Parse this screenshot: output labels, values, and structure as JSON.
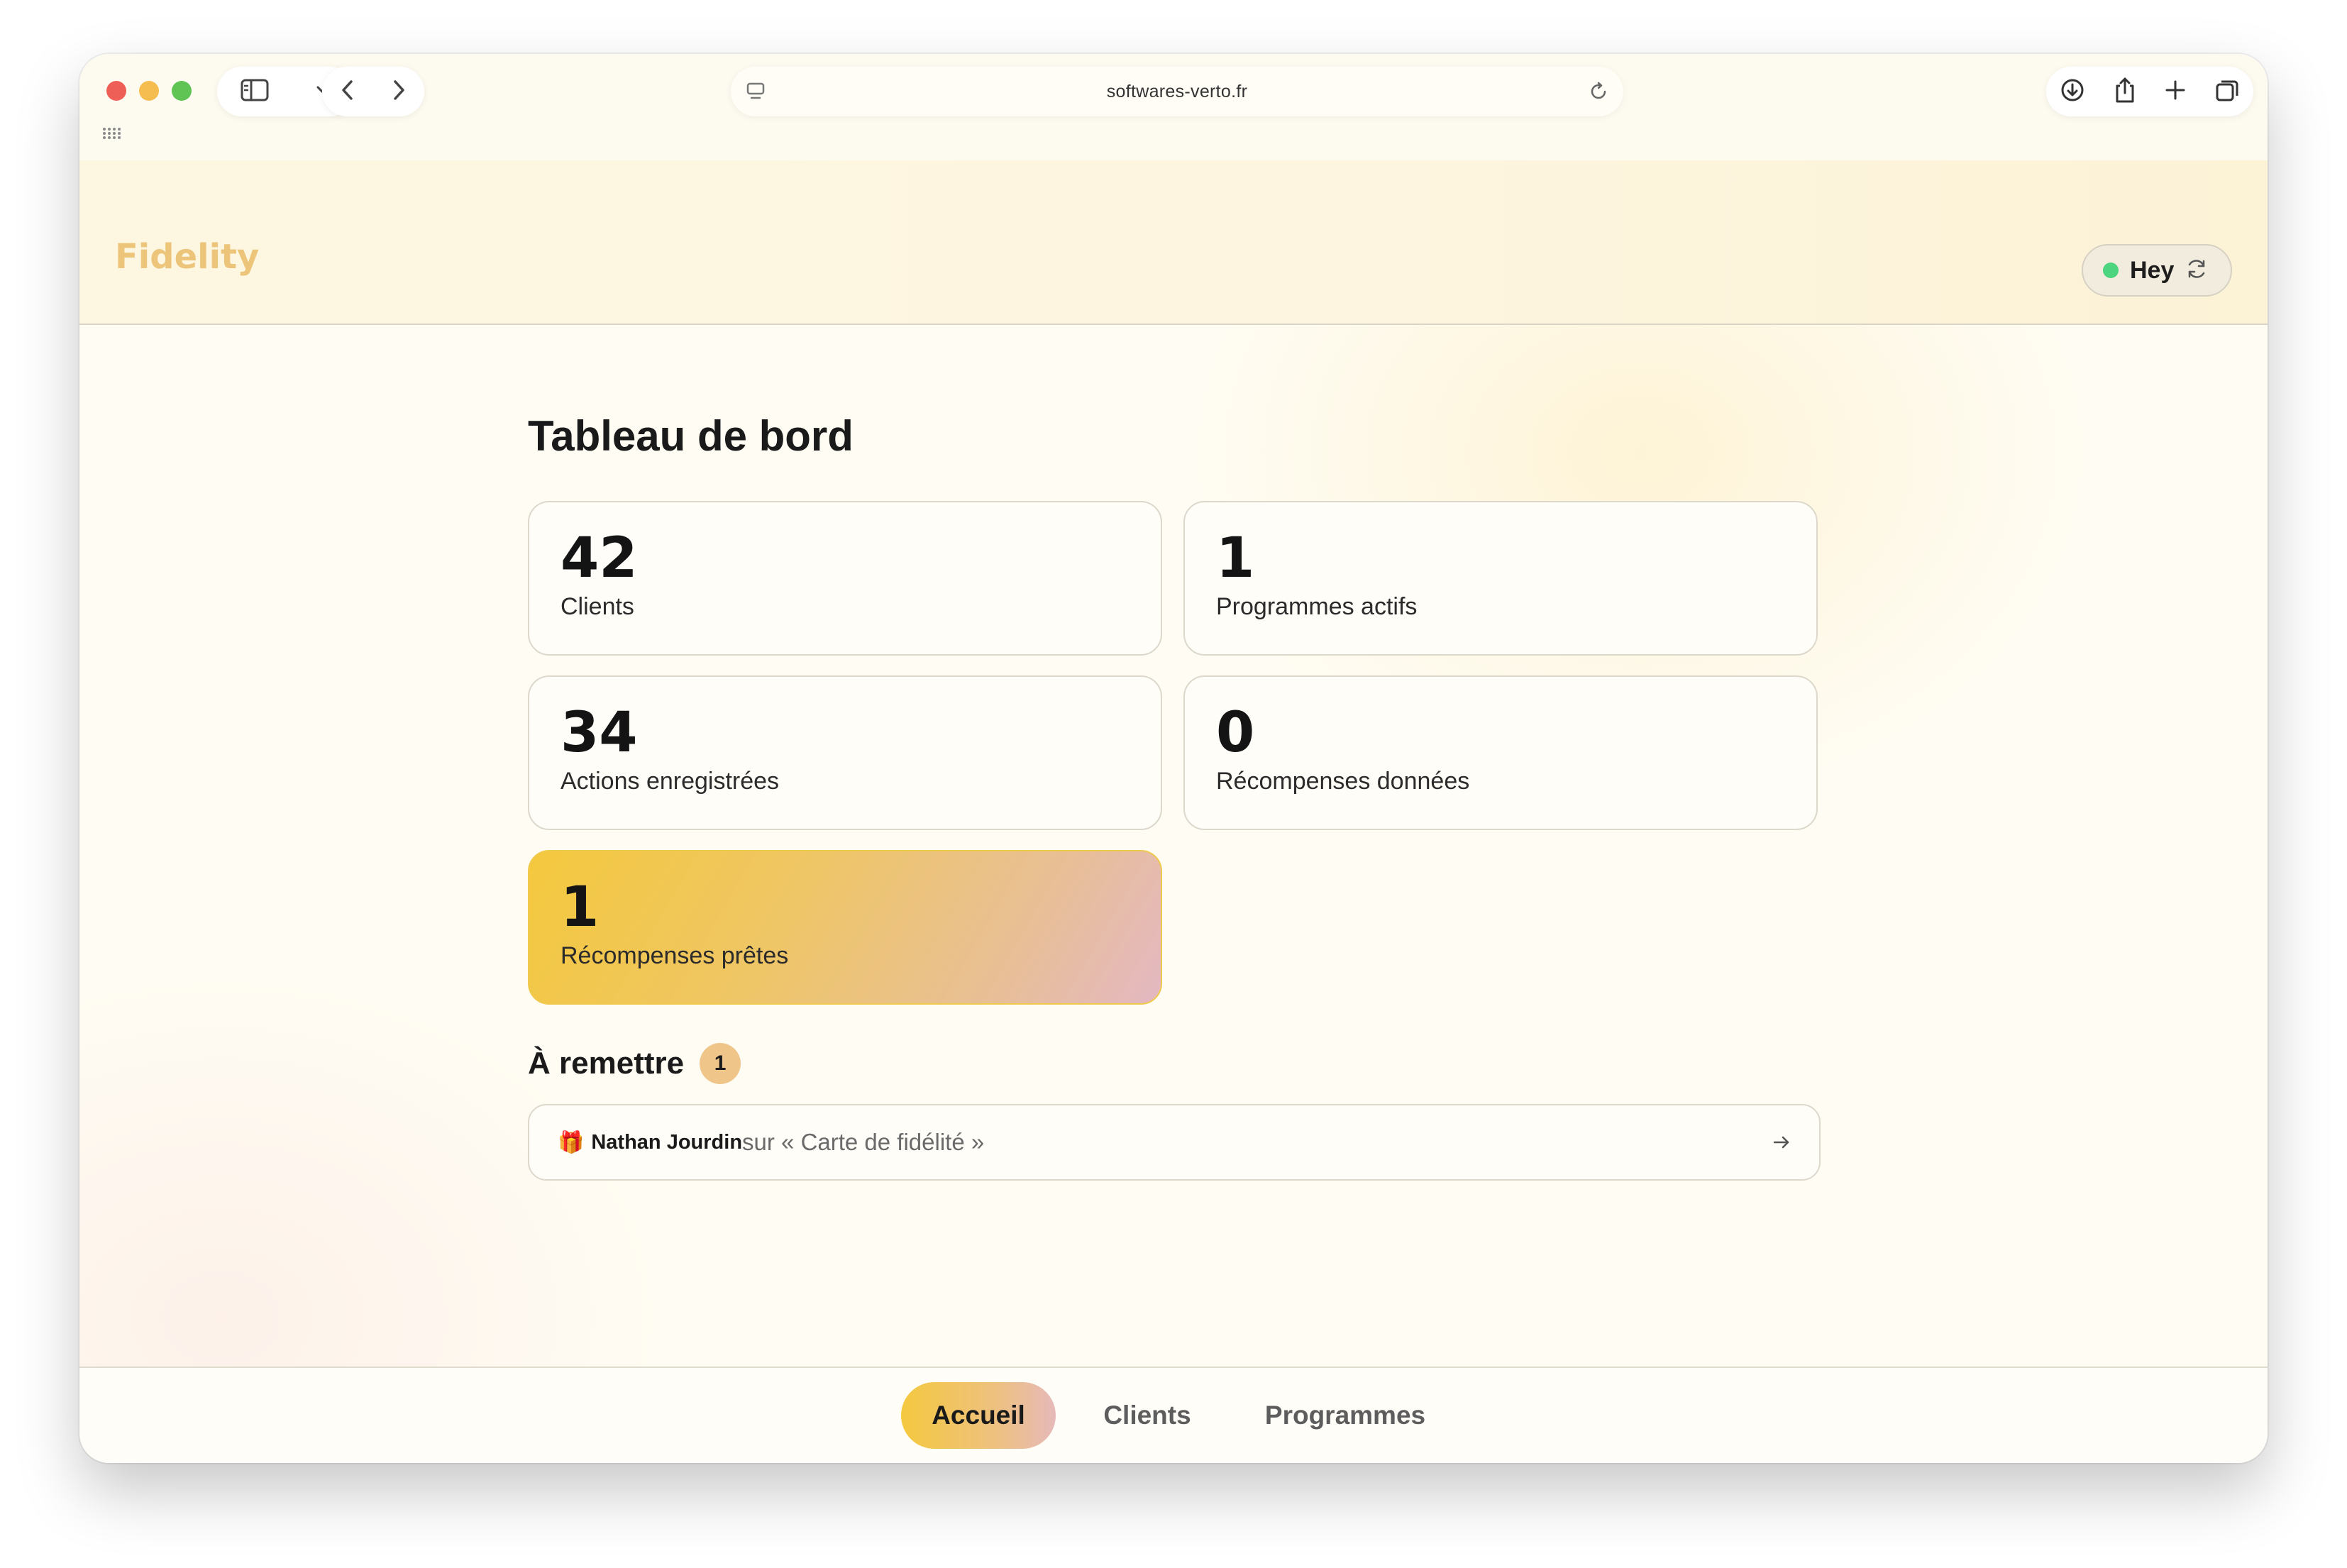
{
  "browser": {
    "url": "softwares-verto.fr"
  },
  "app": {
    "brand": "Fidelity",
    "user": {
      "name": "Hey",
      "status_color": "#4cd47f"
    }
  },
  "dashboard": {
    "title": "Tableau de bord",
    "stats": [
      {
        "value": "42",
        "label": "Clients"
      },
      {
        "value": "1",
        "label": "Programmes actifs"
      },
      {
        "value": "34",
        "label": "Actions enregistrées"
      },
      {
        "value": "0",
        "label": "Récompenses données"
      },
      {
        "value": "1",
        "label": "Récompenses prêtes"
      }
    ]
  },
  "to_deliver": {
    "title": "À remettre",
    "count": "1",
    "items": [
      {
        "icon": "gift-icon",
        "glyph": "🎁",
        "client": "Nathan Jourdin",
        "program_text": "sur « Carte de fidélité »"
      }
    ]
  },
  "bottom_nav": {
    "tabs": [
      {
        "label": "Accueil",
        "active": true
      },
      {
        "label": "Clients",
        "active": false
      },
      {
        "label": "Programmes",
        "active": false
      }
    ]
  },
  "colors": {
    "brand": "#ecc57a",
    "highlight_start": "#f4c83d",
    "highlight_end": "#e4b8c2"
  }
}
